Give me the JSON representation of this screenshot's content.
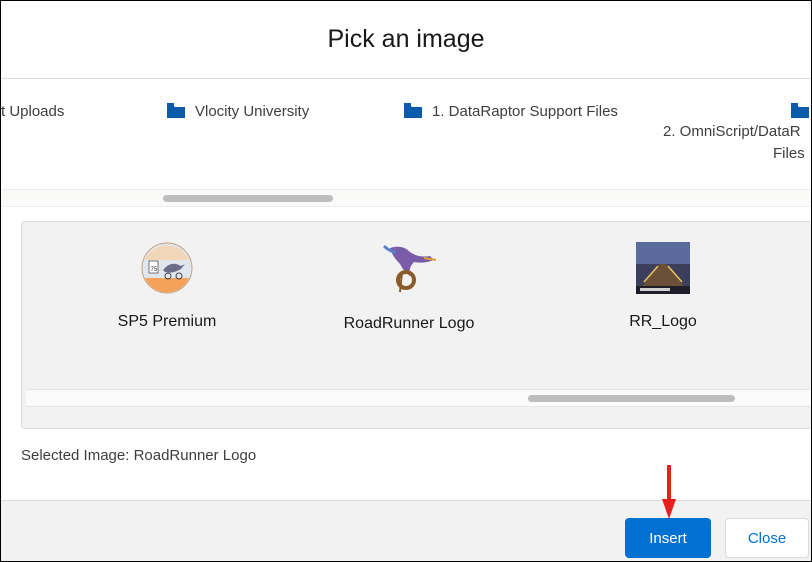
{
  "modal": {
    "title": "Pick an image"
  },
  "folders": [
    {
      "label": "t Uploads",
      "icon": "folder-icon"
    },
    {
      "label": "Vlocity University",
      "icon": "folder-icon"
    },
    {
      "label": "1. DataRaptor Support Files",
      "icon": "folder-icon"
    },
    {
      "label_line1": "2. OmniScript/DataR",
      "label_line2": "Files",
      "icon": "folder-icon"
    }
  ],
  "images": [
    {
      "label": "SP5 Premium",
      "thumb": "sp5-premium-thumbnail"
    },
    {
      "label": "RoadRunner Logo",
      "thumb": "roadrunner-logo-thumbnail"
    },
    {
      "label": "RR_Logo",
      "thumb": "rr-logo-thumbnail"
    }
  ],
  "selection": {
    "text": "Selected Image: RoadRunner Logo"
  },
  "footer": {
    "insert_label": "Insert",
    "close_label": "Close"
  },
  "colors": {
    "brand_blue": "#0070d2",
    "annotation_arrow": "#e8201a"
  }
}
